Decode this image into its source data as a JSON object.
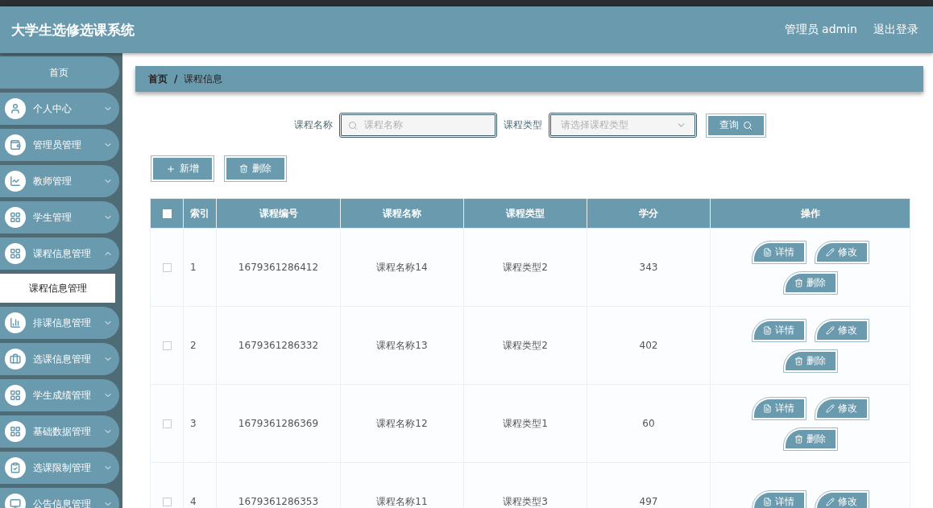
{
  "header": {
    "title": "大学生选修选课系统",
    "user": "管理员 admin",
    "logout": "退出登录"
  },
  "sidebar": {
    "items": [
      {
        "kind": "home",
        "label": "首页"
      },
      {
        "kind": "menu",
        "label": "个人中心",
        "expanded": false
      },
      {
        "kind": "menu",
        "label": "管理员管理",
        "expanded": false
      },
      {
        "kind": "menu",
        "label": "教师管理",
        "expanded": false
      },
      {
        "kind": "menu",
        "label": "学生管理",
        "expanded": false
      },
      {
        "kind": "menu",
        "label": "课程信息管理",
        "expanded": true,
        "children": [
          {
            "label": "课程信息管理",
            "selected": true
          }
        ]
      },
      {
        "kind": "menu",
        "label": "排课信息管理",
        "expanded": false
      },
      {
        "kind": "menu",
        "label": "选课信息管理",
        "expanded": false
      },
      {
        "kind": "menu",
        "label": "学生成绩管理",
        "expanded": false
      },
      {
        "kind": "menu",
        "label": "基础数据管理",
        "expanded": false
      },
      {
        "kind": "menu",
        "label": "选课限制管理",
        "expanded": false
      },
      {
        "kind": "menu",
        "label": "公告信息管理",
        "expanded": false
      }
    ]
  },
  "breadcrumb": [
    "首页",
    "课程信息"
  ],
  "breadcrumb_separator": "/",
  "search": {
    "name_label": "课程名称",
    "name_placeholder": "课程名称",
    "type_label": "课程类型",
    "type_placeholder": "请选择课程类型",
    "query_button": "查询"
  },
  "toolbar": {
    "add_button": "新增",
    "delete_button": "删除"
  },
  "table": {
    "select_all_checked": false,
    "columns": [
      "索引",
      "课程编号",
      "课程名称",
      "课程类型",
      "学分",
      "操作"
    ],
    "rows": [
      {
        "index": "1",
        "code": "1679361286412",
        "name": "课程名称14",
        "type": "课程类型2",
        "credits": "343",
        "checked": false,
        "actions": [
          "详情",
          "修改",
          "删除"
        ]
      },
      {
        "index": "2",
        "code": "1679361286332",
        "name": "课程名称13",
        "type": "课程类型2",
        "credits": "402",
        "checked": false,
        "actions": [
          "详情",
          "修改",
          "删除"
        ]
      },
      {
        "index": "3",
        "code": "1679361286369",
        "name": "课程名称12",
        "type": "课程类型1",
        "credits": "60",
        "checked": false,
        "actions": [
          "详情",
          "修改",
          "删除"
        ]
      },
      {
        "index": "4",
        "code": "1679361286353",
        "name": "课程名称11",
        "type": "课程类型3",
        "credits": "497",
        "checked": false,
        "actions": [
          "详情",
          "修改"
        ]
      }
    ]
  }
}
